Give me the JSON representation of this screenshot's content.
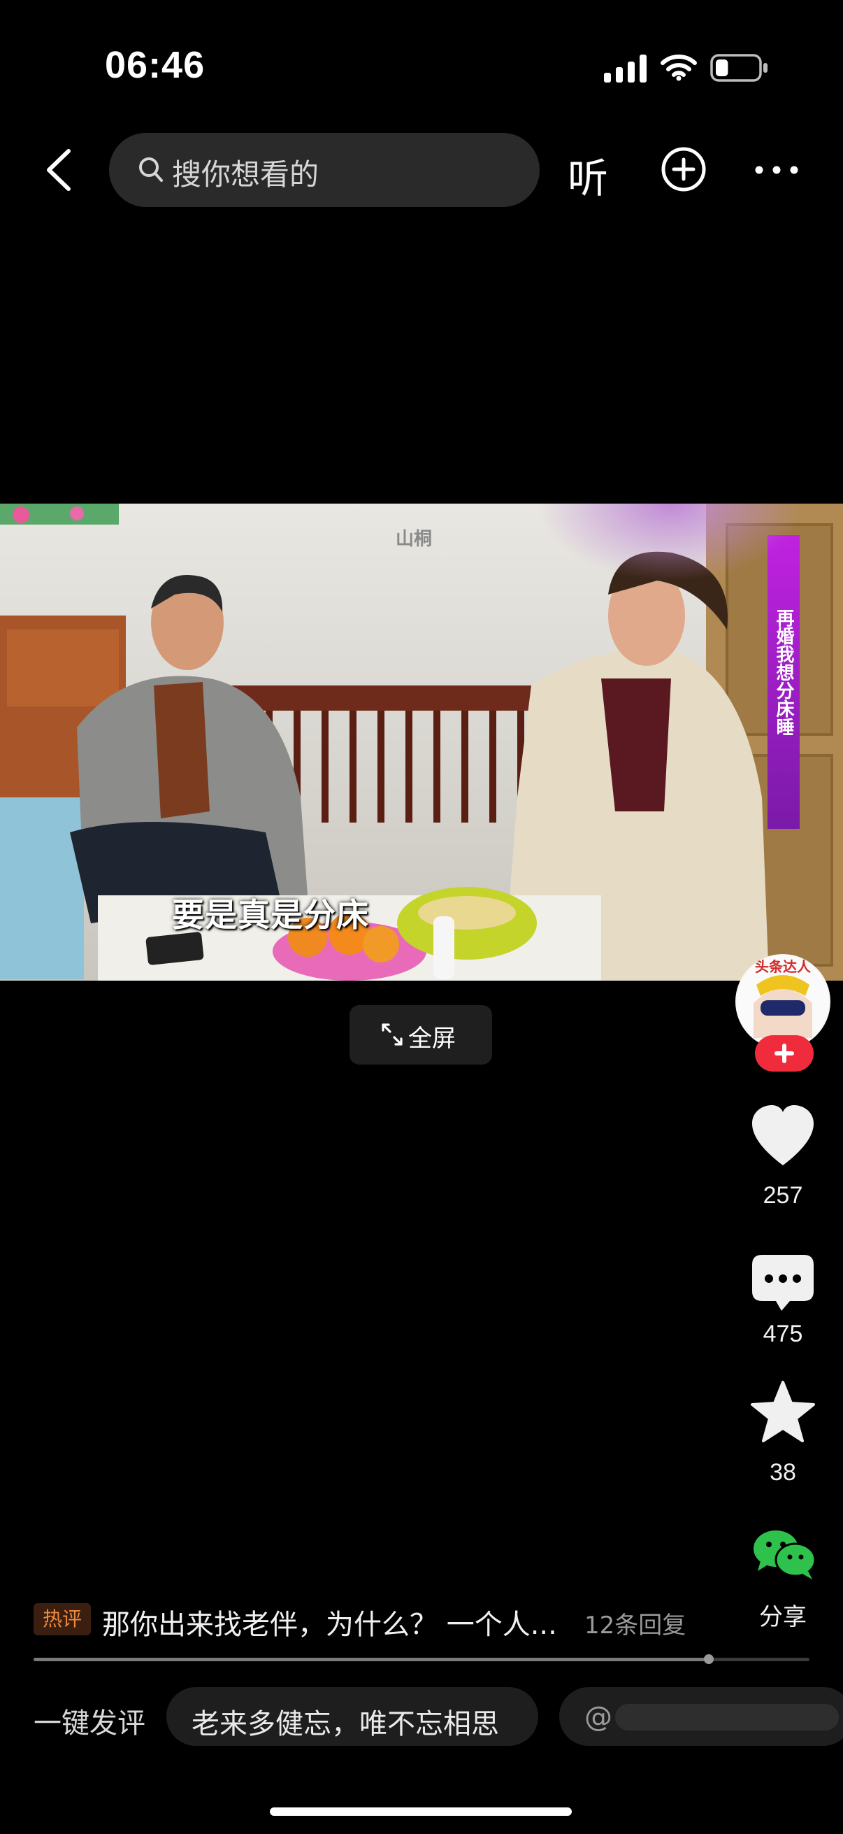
{
  "status_bar": {
    "time": "06:46",
    "battery_level": 0.3
  },
  "top_bar": {
    "search_placeholder": "搜你想看的",
    "listen_label": "听"
  },
  "video": {
    "watermark": "山桐",
    "subtitle": "要是真是分床",
    "side_banner": "再婚我想分床睡",
    "avatar_badge": "头条达人",
    "fullscreen_label": "全屏",
    "progress": 0.87
  },
  "actions": {
    "like_count": "257",
    "comment_count": "475",
    "favorite_count": "38",
    "share_label": "分享"
  },
  "comments": {
    "hot_tag": "热评",
    "hot_text": "那你出来找老伴，为什么？ 一个人...",
    "reply_count": "12条回复",
    "one_click_label": "一键发评",
    "suggestions": [
      "老来多健忘，唯不忘相思",
      "@"
    ]
  },
  "colors": {
    "background": "#000000",
    "search_bg": "#2a2a2a",
    "follow_red": "#f02c3c",
    "share_green": "#2ec24d",
    "hot_tag": "#f08a3c"
  }
}
